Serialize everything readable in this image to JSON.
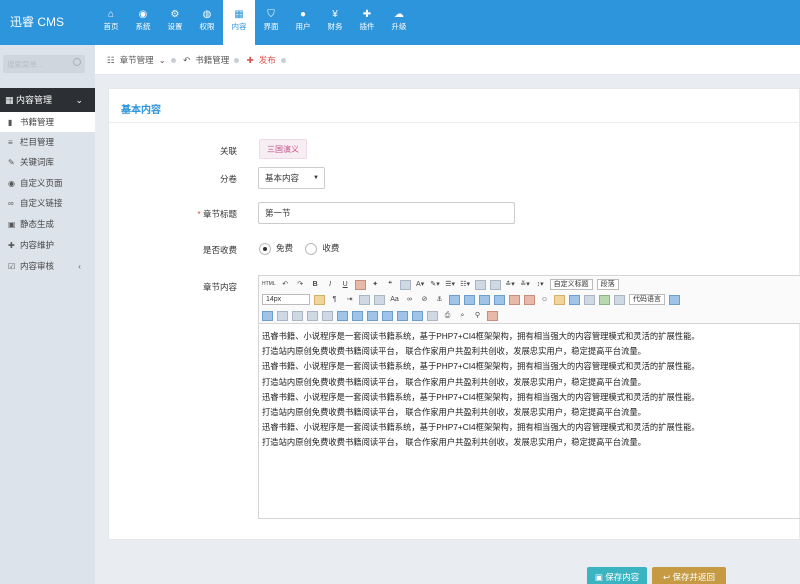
{
  "brand": "迅睿 CMS",
  "nav": [
    {
      "label": "首页",
      "icon": "⌂"
    },
    {
      "label": "系统",
      "icon": "◉"
    },
    {
      "label": "设置",
      "icon": "⚙"
    },
    {
      "label": "权限",
      "icon": "◍"
    },
    {
      "label": "内容",
      "icon": "▦"
    },
    {
      "label": "界面",
      "icon": "⛉"
    },
    {
      "label": "用户",
      "icon": "●"
    },
    {
      "label": "财务",
      "icon": "¥"
    },
    {
      "label": "插件",
      "icon": "✚"
    },
    {
      "label": "升级",
      "icon": "☁"
    }
  ],
  "sidebar": {
    "search_placeholder": "搜索菜单...",
    "section_title": "内容管理",
    "items": [
      {
        "label": "书籍管理",
        "icon": "▮"
      },
      {
        "label": "栏目管理",
        "icon": "≡"
      },
      {
        "label": "关键词库",
        "icon": "✎"
      },
      {
        "label": "自定义页面",
        "icon": "◉"
      },
      {
        "label": "自定义链接",
        "icon": "∞"
      },
      {
        "label": "静态生成",
        "icon": "▣"
      },
      {
        "label": "内容维护",
        "icon": "✚"
      },
      {
        "label": "内容审核",
        "icon": "☑"
      }
    ]
  },
  "breadcrumb": {
    "chapter_mgmt": "章节管理",
    "book_mgmt": "书籍管理",
    "publish": "发布"
  },
  "panel": {
    "title": "基本内容",
    "related_label": "关联",
    "related_value": "三国演义",
    "volume_label": "分卷",
    "volume_value": "基本内容",
    "chapter_title_label": "章节标题",
    "chapter_title_value": "第一节",
    "charge_label": "是否收费",
    "charge_options": [
      "免费",
      "收费"
    ],
    "charge_selected": "免费",
    "content_label": "章节内容"
  },
  "editor": {
    "font_size": "14px",
    "custom_title": "自定义标题",
    "paragraph": "段落",
    "code_lang": "代码语言",
    "lines": [
      "迅睿书籍、小说程序是一套阅读书籍系统，基于PHP7+CI4框架架构，拥有相当强大的内容管理模式和灵活的扩展性能。",
      "打造站内原创免费收费书籍阅读平台， 联合作家用户共盈利共创收，发展忠实用户，稳定提高平台流量。",
      "迅睿书籍、小说程序是一套阅读书籍系统，基于PHP7+CI4框架架构，拥有相当强大的内容管理模式和灵活的扩展性能。",
      "打造站内原创免费收费书籍阅读平台， 联合作家用户共盈利共创收，发展忠实用户，稳定提高平台流量。",
      "迅睿书籍、小说程序是一套阅读书籍系统，基于PHP7+CI4框架架构，拥有相当强大的内容管理模式和灵活的扩展性能。",
      "打造站内原创免费收费书籍阅读平台， 联合作家用户共盈利共创收，发展忠实用户，稳定提高平台流量。",
      "迅睿书籍、小说程序是一套阅读书籍系统，基于PHP7+CI4框架架构，拥有相当强大的内容管理模式和灵活的扩展性能。",
      "打造站内原创免费收费书籍阅读平台， 联合作家用户共盈利共创收，发展忠实用户，稳定提高平台流量。"
    ]
  },
  "buttons": {
    "save": "保存内容",
    "save_back": "保存并返回"
  },
  "colors": {
    "topbar": "#2c95dc",
    "save": "#3bb4c1",
    "save_back": "#c69a43"
  }
}
